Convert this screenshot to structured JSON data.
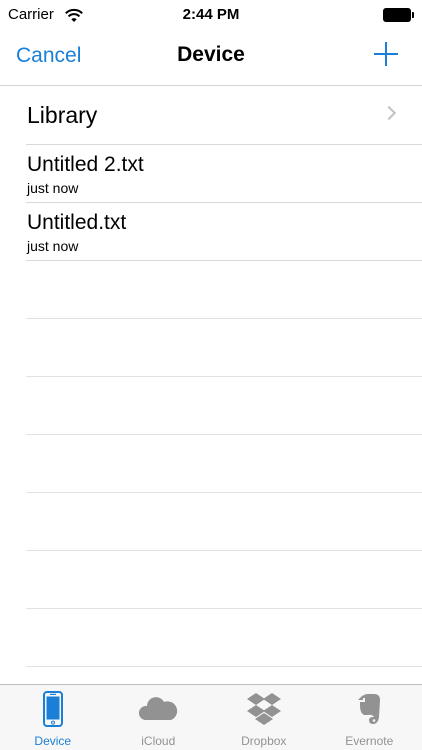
{
  "status_bar": {
    "carrier": "Carrier",
    "time": "2:44 PM"
  },
  "nav": {
    "cancel_label": "Cancel",
    "title": "Device",
    "add_icon": "plus-icon"
  },
  "list": {
    "library_label": "Library",
    "files": [
      {
        "name": "Untitled 2.txt",
        "modified": "just now"
      },
      {
        "name": "Untitled.txt",
        "modified": "just now"
      }
    ]
  },
  "tabs": [
    {
      "label": "Device",
      "icon": "phone-icon",
      "active": true
    },
    {
      "label": "iCloud",
      "icon": "cloud-icon",
      "active": false
    },
    {
      "label": "Dropbox",
      "icon": "dropbox-icon",
      "active": false
    },
    {
      "label": "Evernote",
      "icon": "evernote-icon",
      "active": false
    }
  ],
  "colors": {
    "accent": "#1a7fd6",
    "inactive_tab": "#929292",
    "separator": "#d9d9d9"
  }
}
